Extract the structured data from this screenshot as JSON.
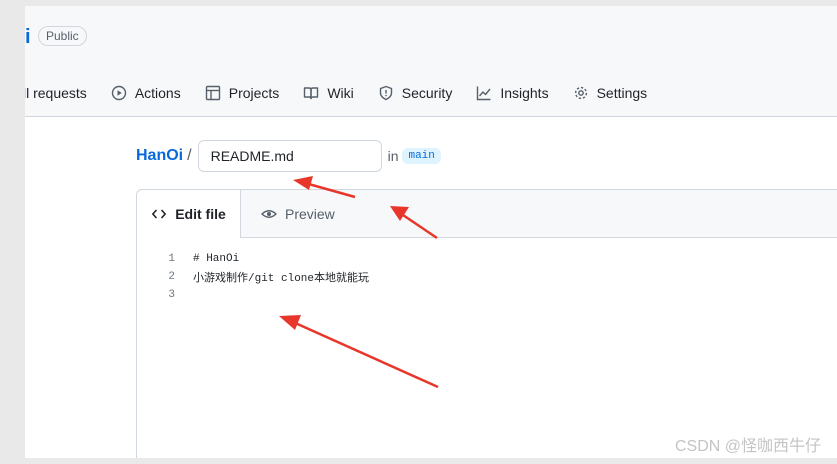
{
  "repo": {
    "name_fragment": "i",
    "visibility": "Public"
  },
  "nav": {
    "items": [
      {
        "label": "ll requests",
        "icon": "pull-request-icon"
      },
      {
        "label": "Actions",
        "icon": "play-icon"
      },
      {
        "label": "Projects",
        "icon": "table-icon"
      },
      {
        "label": "Wiki",
        "icon": "book-icon"
      },
      {
        "label": "Security",
        "icon": "shield-icon"
      },
      {
        "label": "Insights",
        "icon": "graph-icon"
      },
      {
        "label": "Settings",
        "icon": "gear-icon"
      }
    ]
  },
  "breadcrumb": {
    "owner": "HanOi",
    "separator": "/",
    "filename": "README.md",
    "in_label": "in",
    "branch": "main"
  },
  "editor": {
    "tabs": {
      "edit": "Edit file",
      "preview": "Preview"
    },
    "lines": [
      {
        "num": "1",
        "text": "# HanOi"
      },
      {
        "num": "2",
        "text": "小游戏制作/git clone本地就能玩"
      },
      {
        "num": "3",
        "text": ""
      }
    ]
  },
  "watermark": "CSDN @怪咖西牛仔",
  "colors": {
    "link": "#0969da",
    "arrow": "#e8362b",
    "border": "#d0d7de"
  }
}
